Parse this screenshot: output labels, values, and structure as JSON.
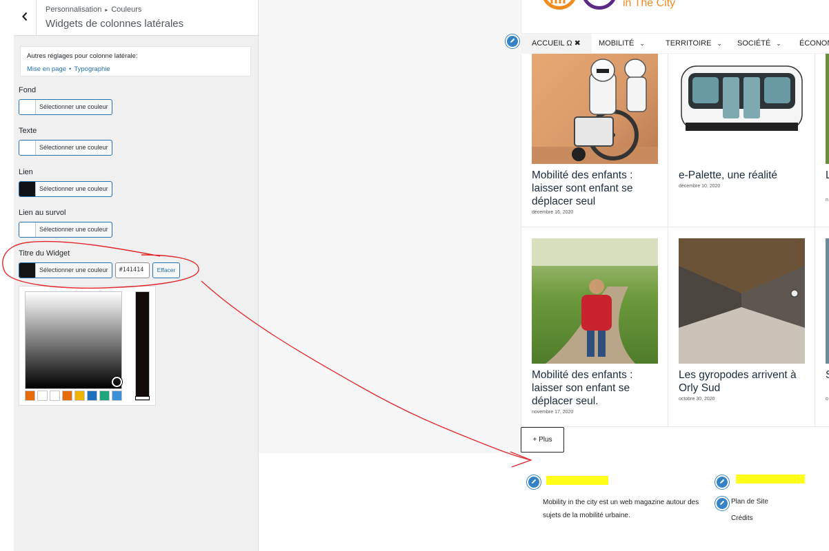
{
  "customizer": {
    "breadcrumb": [
      "Personnalisation",
      "Couleurs"
    ],
    "breadcrumb_sep": "▸",
    "title": "Widgets de colonnes latérales",
    "notice": {
      "label": "Autres réglages pour colonne latérale:",
      "link1": "Mise en page",
      "sep": "•",
      "link2": "Typographie"
    },
    "select_label": "Sélectionner une couleur",
    "settings": [
      {
        "label": "Fond",
        "swatch": "#ffffff"
      },
      {
        "label": "Texte",
        "swatch": "#ffffff"
      },
      {
        "label": "Lien",
        "swatch": "#0e1116"
      },
      {
        "label": "Lien au survol",
        "swatch": "#ffffff"
      },
      {
        "label": "Titre du Widget",
        "swatch": "#141414",
        "hex": "#141414",
        "clear_label": "Effacer"
      }
    ],
    "picker": {
      "hue_color": "#140b0b",
      "palette": [
        "#e66c0a",
        "#ffffff",
        "#ffffff",
        "#e66c0a",
        "#f0b400",
        "#1f6fbf",
        "#1ea67a",
        "#3b8fd9"
      ]
    }
  },
  "preview": {
    "logo_text": "in The City",
    "nav": [
      {
        "label": "ACCUEIL Ω ✖",
        "active": true
      },
      {
        "label": "MOBILITÉ",
        "chevron": "⌄"
      },
      {
        "label": "TERRITOIRE",
        "chevron": "⌄"
      },
      {
        "label": "SOCIÉTÉ",
        "chevron": "⌄"
      },
      {
        "label": "ÉCONOM"
      }
    ],
    "posts": [
      {
        "title": "Mobilité des enfants : laisser sont enfant se déplacer seul",
        "date": "décembre 16, 2020"
      },
      {
        "title": "e-Palette, une réalité",
        "date": "décembre 10, 2020"
      },
      {
        "title": "Mobilité des enfants : laisser son enfant se déplacer seul.",
        "date": "novembre 17, 2020"
      },
      {
        "title": "Les gyropodes arrivent à Orly Sud",
        "date": "octobre 30, 2020"
      }
    ],
    "partial_titles": [
      "L e",
      "S l"
    ],
    "partial_dates": [
      "n",
      "o"
    ],
    "more_label": "+ Plus",
    "footer": {
      "about": "Mobility in the city est un web magazine autour des sujets de la mobilité urbaine.",
      "links": [
        "Plan de Site",
        "Crédits"
      ]
    },
    "highlight_color": "#ffff1a"
  },
  "annotation": {
    "color": "#e3262b"
  }
}
